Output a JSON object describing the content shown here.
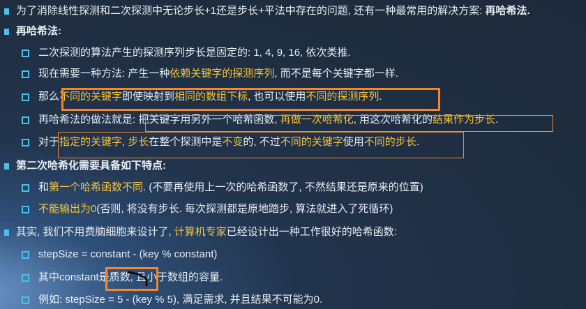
{
  "lines": [
    {
      "level": 1,
      "segments": [
        {
          "t": "为了消除线性探测和二次探测中无论步长+1还是步长+平法中存在的问题, 还有一种最常用的解决方案: "
        },
        {
          "t": "再哈希法.",
          "b": true
        }
      ]
    },
    {
      "level": 1,
      "segments": [
        {
          "t": "再哈希法:",
          "b": true
        }
      ]
    },
    {
      "level": 2,
      "segments": [
        {
          "t": "二次探测的算法产生的探测序列步长是固定的: 1, 4, 9, 16, 依次类推."
        }
      ]
    },
    {
      "level": 2,
      "segments": [
        {
          "t": "现在需要一种方法: 产生一种"
        },
        {
          "t": "依赖关键字的探测序列",
          "h": true
        },
        {
          "t": ", 而不是每个关键字都一样."
        }
      ]
    },
    {
      "level": 2,
      "segments": [
        {
          "t": "那么"
        },
        {
          "t": "不同的关键字",
          "h": true
        },
        {
          "t": "即使映射到"
        },
        {
          "t": "相同的数组下标",
          "h": true
        },
        {
          "t": ", 也可以使用"
        },
        {
          "t": "不同的探测序列",
          "h": true
        },
        {
          "t": "."
        }
      ]
    },
    {
      "level": 2,
      "segments": [
        {
          "t": "再哈希法的做法就是: 把关键字用另外一个哈希函数, "
        },
        {
          "t": "再做一次哈希化",
          "h": true
        },
        {
          "t": ", 用这次哈希化的"
        },
        {
          "t": "结果作为步长",
          "h": true
        },
        {
          "t": "."
        }
      ]
    },
    {
      "level": 2,
      "segments": [
        {
          "t": "对于"
        },
        {
          "t": "指定的关键字",
          "h": true
        },
        {
          "t": ", "
        },
        {
          "t": "步长",
          "h": true
        },
        {
          "t": "在整个探测中是"
        },
        {
          "t": "不变",
          "h": true
        },
        {
          "t": "的, 不过"
        },
        {
          "t": "不同的关键字",
          "h": true
        },
        {
          "t": "使用"
        },
        {
          "t": "不同的步长",
          "h": true
        },
        {
          "t": "."
        }
      ]
    },
    {
      "level": 1,
      "segments": [
        {
          "t": "第二次哈希化需要具备如下特点:",
          "b": true
        }
      ]
    },
    {
      "level": 2,
      "segments": [
        {
          "t": "和"
        },
        {
          "t": "第一个哈希函数不同",
          "h": true
        },
        {
          "t": ". (不要再使用上一次的哈希函数了, 不然结果还是原来的位置)"
        }
      ]
    },
    {
      "level": 2,
      "segments": [
        {
          "t": "不能输出为0",
          "h": true
        },
        {
          "t": "(否则, 将没有步长. 每次探测都是原地踏步, 算法就进入了死循环)"
        }
      ]
    },
    {
      "level": 1,
      "segments": [
        {
          "t": "其实, 我们不用费脑细胞来设计了, "
        },
        {
          "t": "计算机专家",
          "h": true
        },
        {
          "t": "已经设计出一种工作很好的哈希函数:"
        }
      ]
    },
    {
      "level": 2,
      "segments": [
        {
          "t": "stepSize = constant - (key % constant)"
        }
      ]
    },
    {
      "level": 2,
      "segments": [
        {
          "t": "其中constant是质数, 且小于数组的容量."
        }
      ]
    },
    {
      "level": 2,
      "segments": [
        {
          "t": "例如: stepSize = 5 - (key % 5), 满足需求, 并且结果不可能为0."
        }
      ]
    }
  ],
  "colors": {
    "highlight": "#f5c53a",
    "bullet": "#4ac0ea",
    "box": "#f5862a"
  }
}
